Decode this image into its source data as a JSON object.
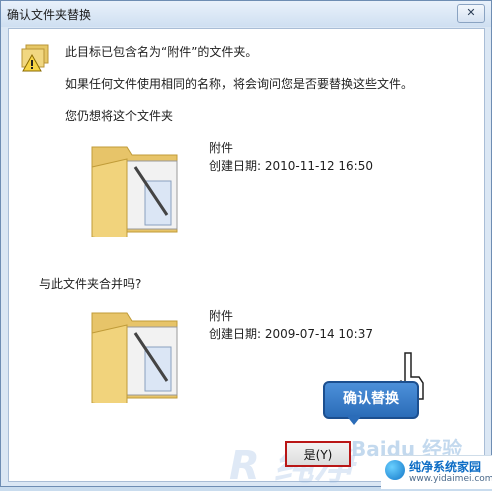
{
  "window": {
    "title": "确认文件夹替换",
    "close_label": "✕"
  },
  "dialog": {
    "line1": "此目标已包含名为“附件”的文件夹。",
    "line2": "如果任何文件使用相同的名称，将会询问您是否要替换这些文件。",
    "prompt_keep": "您仍想将这个文件夹",
    "prompt_merge": "与此文件夹合并吗?",
    "folder_top": {
      "name": "附件",
      "date_label": "创建日期: 2010-11-12 16:50"
    },
    "folder_bottom": {
      "name": "附件",
      "date_label": "创建日期: 2009-07-14 10:37"
    },
    "yes_button_label": "是(Y)"
  },
  "annotation": {
    "callout_text": "确认替换"
  },
  "watermarks": {
    "baidu": "Baidu 经验",
    "r_mark": "R 纯净"
  },
  "brand": {
    "name": "纯净系统家园",
    "url": "www.yidaimei.com"
  }
}
